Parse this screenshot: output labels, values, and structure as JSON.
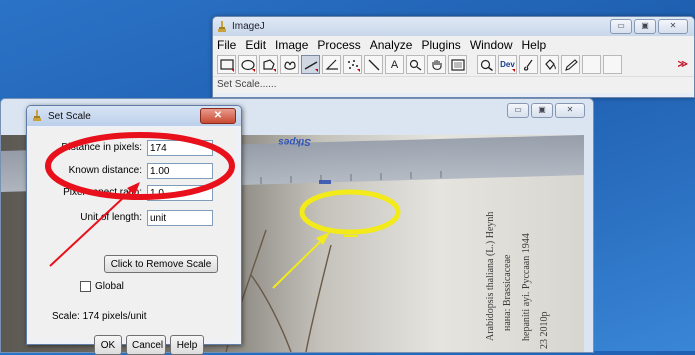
{
  "main_window": {
    "title": "ImageJ",
    "window_buttons": [
      "▭",
      "▣",
      "✕"
    ],
    "menu": [
      "File",
      "Edit",
      "Image",
      "Process",
      "Analyze",
      "Plugins",
      "Window",
      "Help"
    ],
    "status_text": "Set Scale......",
    "dev_label": "Dev",
    "more_tools": "≫",
    "tools": [
      {
        "icon": "rectangle-icon"
      },
      {
        "icon": "oval-icon"
      },
      {
        "icon": "polygon-icon"
      },
      {
        "icon": "freehand-icon"
      },
      {
        "icon": "straight-line-icon",
        "selected": true
      },
      {
        "icon": "angle-icon"
      },
      {
        "icon": "multipoint-icon"
      },
      {
        "icon": "wand-icon"
      },
      {
        "icon": "text-tool-icon",
        "glyph": "A"
      },
      {
        "icon": "magnifier-icon"
      },
      {
        "icon": "hand-icon"
      },
      {
        "icon": "color-picker-icon"
      }
    ]
  },
  "image_window": {
    "window_buttons": [
      "▭",
      "▣",
      "✕"
    ],
    "photo_text": {
      "ruler_word": "Stkpes",
      "label_line1": "Arabidopsis thaliana (L.) Heynh",
      "label_line2": "нана: Brassicaceae",
      "label_line3": "hepaniti ayi. Pyccaan 1944",
      "label_line4": "23 2010p"
    }
  },
  "dialog": {
    "title": "Set Scale",
    "close_glyph": "✕",
    "fields": {
      "distance_label": "Distance in pixels:",
      "distance_value": "174",
      "known_label": "Known distance:",
      "known_value": "1.00",
      "aspect_label": "Pixel aspect ratio:",
      "aspect_value": "1.0",
      "unit_label": "Unit of length:",
      "unit_value": "unit"
    },
    "remove_button": "Click to Remove Scale",
    "global_label": "Global",
    "global_checked": false,
    "scale_info": "Scale: 174 pixels/unit",
    "buttons": {
      "ok": "OK",
      "cancel": "Cancel",
      "help": "Help"
    }
  },
  "annotations": {
    "red_color": "#e8101a",
    "yellow_color": "#f3ea1a"
  }
}
